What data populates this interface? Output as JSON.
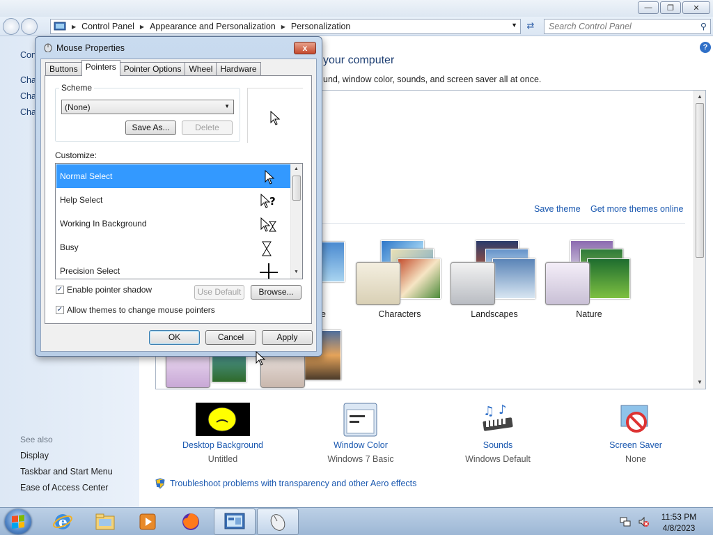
{
  "addressbar": {
    "crumbs": [
      "Control Panel",
      "Appearance and Personalization",
      "Personalization"
    ],
    "search_placeholder": "Search Control Panel"
  },
  "left_pane": {
    "items": [
      "Con",
      "Cha",
      "Cha",
      "Cha"
    ],
    "see_also_label": "See also",
    "see_also": [
      "Display",
      "Taskbar and Start Menu",
      "Ease of Access Center"
    ]
  },
  "main": {
    "heading": "your computer",
    "subheading": "und, window color, sounds, and screen saver all at once.",
    "save_theme": "Save theme",
    "get_more_themes": "Get more themes online",
    "partial_label": "e",
    "themes": [
      {
        "label": "Characters"
      },
      {
        "label": "Landscapes"
      },
      {
        "label": "Nature"
      }
    ]
  },
  "bottom": {
    "items": [
      {
        "label": "Desktop Background",
        "sub": "Untitled"
      },
      {
        "label": "Window Color",
        "sub": "Windows 7 Basic"
      },
      {
        "label": "Sounds",
        "sub": "Windows Default"
      },
      {
        "label": "Screen Saver",
        "sub": "None"
      }
    ],
    "troubleshoot": "Troubleshoot problems with transparency and other Aero effects"
  },
  "dialog": {
    "title": "Mouse Properties",
    "close": "x",
    "tabs": [
      "Buttons",
      "Pointers",
      "Pointer Options",
      "Wheel",
      "Hardware"
    ],
    "active_tab": "Pointers",
    "scheme_label": "Scheme",
    "scheme_value": "(None)",
    "save_as": "Save As...",
    "delete": "Delete",
    "customize_label": "Customize:",
    "list_items": [
      "Normal Select",
      "Help Select",
      "Working In Background",
      "Busy",
      "Precision Select"
    ],
    "enable_shadow": "Enable pointer shadow",
    "use_default": "Use Default",
    "browse": "Browse...",
    "allow_themes": "Allow themes to change mouse pointers",
    "ok": "OK",
    "cancel": "Cancel",
    "apply": "Apply"
  },
  "taskbar": {
    "time": "11:53 PM",
    "date": "4/8/2023"
  }
}
